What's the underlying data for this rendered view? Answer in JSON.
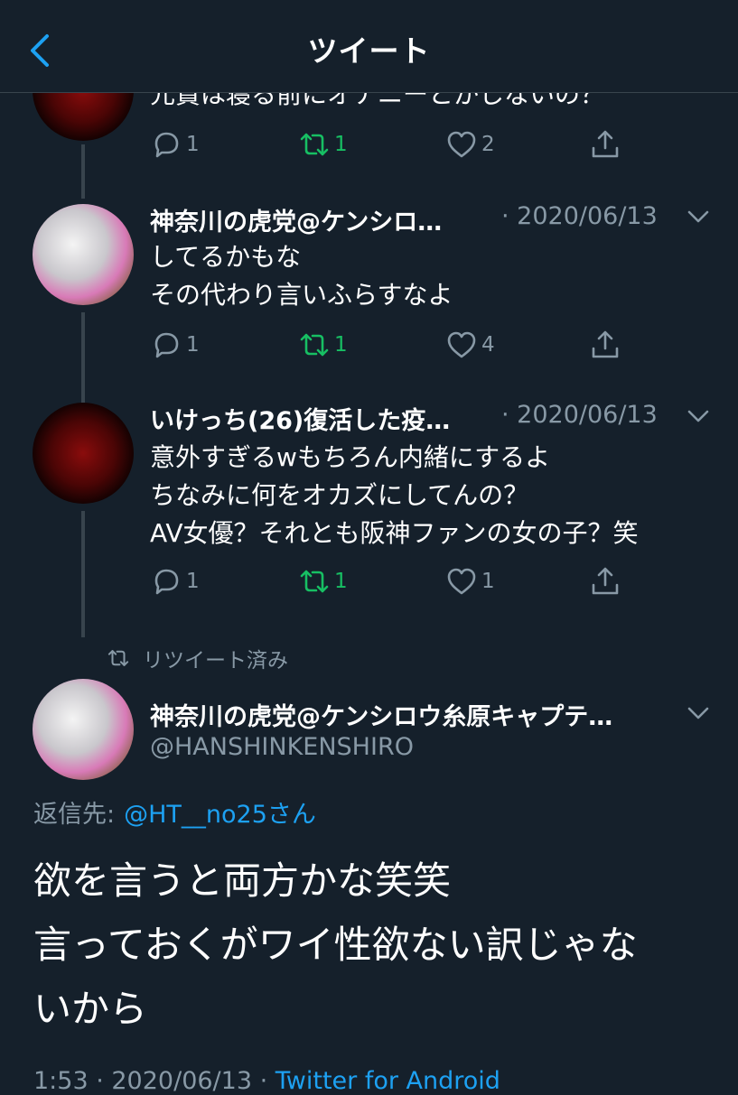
{
  "header": {
    "title": "ツイート",
    "back_icon": "chevron-left-icon"
  },
  "top_tweet_partial": {
    "text": "元貴は寝る前にオナニーとかしないの？",
    "actions": {
      "reply": "1",
      "retweet": "1",
      "like": "2"
    }
  },
  "tweets": [
    {
      "name": "神奈川の虎党@ケンシロ…",
      "date": "· 2020/06/13",
      "lines": [
        "してるかもな",
        "その代わり言いふらすなよ"
      ],
      "actions": {
        "reply": "1",
        "retweet": "1",
        "like": "4"
      }
    },
    {
      "name": "いけっち(26)復活した疫…",
      "date": "· 2020/06/13",
      "lines": [
        "意外すぎるwもちろん内緒にするよ",
        "ちなみに何をオカズにしてんの？",
        "AV女優？それとも阪神ファンの女の子？笑"
      ],
      "actions": {
        "reply": "1",
        "retweet": "1",
        "like": "1"
      }
    }
  ],
  "retweeted_label": "リツイート済み",
  "main_tweet": {
    "name": "神奈川の虎党@ケンシロウ糸原キャプテ…",
    "handle": "@HANSHINKENSHIRO",
    "reply_prefix": "返信先:",
    "reply_to": "@HT__no25さん",
    "text_lines": [
      "欲を言うと両方かな笑笑",
      "言っておくがワイ性欲ない訳じゃな",
      "いから"
    ]
  },
  "footer": {
    "time": "1:53 · 2020/06/13 · ",
    "source": "Twitter for Android"
  },
  "colors": {
    "background": "#15202b",
    "muted": "#8899a6",
    "retweet_green": "#17bf63",
    "link": "#1da1f2",
    "divider": "#38444d"
  }
}
